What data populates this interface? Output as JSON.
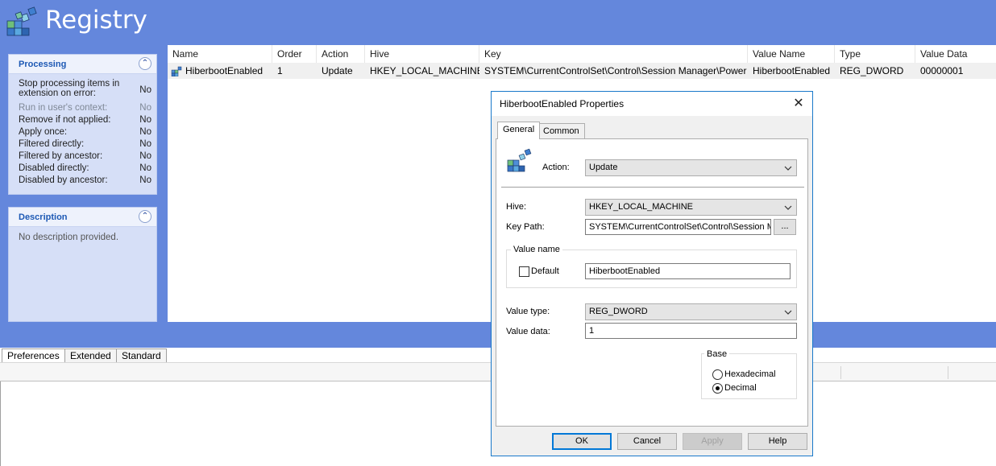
{
  "header": {
    "title": "Registry",
    "icon": "registry-cubes-icon"
  },
  "processing": {
    "title": "Processing",
    "items": [
      {
        "label": "Stop processing items in extension on error:",
        "value": "No",
        "dim": false
      },
      {
        "label": "Run in user's context:",
        "value": "No",
        "dim": true
      },
      {
        "label": "Remove if not applied:",
        "value": "No",
        "dim": false
      },
      {
        "label": "Apply once:",
        "value": "No",
        "dim": false
      },
      {
        "label": "Filtered directly:",
        "value": "No",
        "dim": false
      },
      {
        "label": "Filtered by ancestor:",
        "value": "No",
        "dim": false
      },
      {
        "label": "Disabled directly:",
        "value": "No",
        "dim": false
      },
      {
        "label": "Disabled by ancestor:",
        "value": "No",
        "dim": false
      }
    ]
  },
  "description": {
    "title": "Description",
    "text": "No description provided."
  },
  "list": {
    "columns": [
      "Name",
      "Order",
      "Action",
      "Hive",
      "Key",
      "Value Name",
      "Type",
      "Value Data"
    ],
    "rows": [
      [
        "HiberbootEnabled",
        "1",
        "Update",
        "HKEY_LOCAL_MACHINE",
        "SYSTEM\\CurrentControlSet\\Control\\Session Manager\\Power",
        "HiberbootEnabled",
        "REG_DWORD",
        "00000001"
      ]
    ]
  },
  "bottom_tabs": [
    "Preferences",
    "Extended",
    "Standard"
  ],
  "dialog": {
    "title": "HiberbootEnabled Properties",
    "tabs": [
      "General",
      "Common"
    ],
    "action_label": "Action:",
    "action_value": "Update",
    "hive_label": "Hive:",
    "hive_value": "HKEY_LOCAL_MACHINE",
    "keypath_label": "Key Path:",
    "keypath_value": "SYSTEM\\CurrentControlSet\\Control\\Session Manager\\Power",
    "browse_label": "...",
    "value_name_group": "Value name",
    "default_label": "Default",
    "value_name_value": "HiberbootEnabled",
    "value_type_label": "Value type:",
    "value_type_value": "REG_DWORD",
    "value_data_label": "Value data:",
    "value_data_value": "1",
    "base_group": "Base",
    "hex_label": "Hexadecimal",
    "dec_label": "Decimal",
    "buttons": {
      "ok": "OK",
      "cancel": "Cancel",
      "apply": "Apply",
      "help": "Help"
    }
  }
}
